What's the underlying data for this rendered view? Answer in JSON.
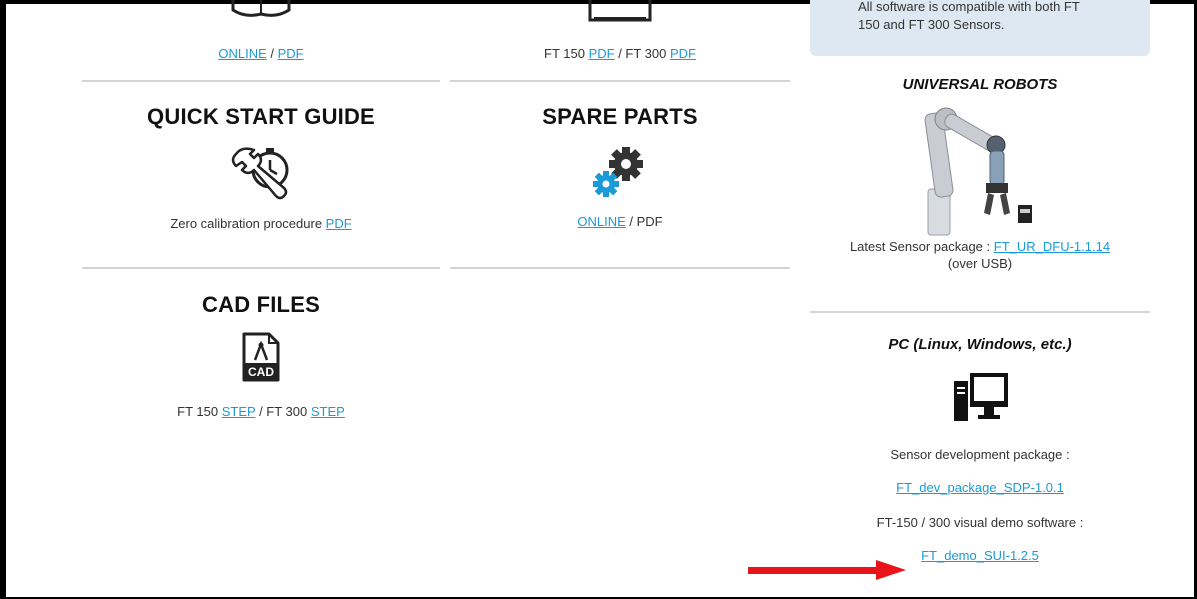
{
  "manuals": {
    "online_label": "ONLINE",
    "sep": " / ",
    "pdf_label": "PDF"
  },
  "drawings": {
    "ft150_text": "FT 150 ",
    "ft150_link": "PDF",
    "mid_text": " / FT 300 ",
    "ft300_link": "PDF"
  },
  "quick_start": {
    "title": "QUICK START GUIDE",
    "text": "Zero calibration procedure ",
    "pdf_link": "PDF"
  },
  "spare_parts": {
    "title": "SPARE PARTS",
    "online_link": "ONLINE",
    "rest": " / PDF"
  },
  "cad_files": {
    "title": "CAD FILES",
    "icon_text": "CAD",
    "ft150_text": "FT 150 ",
    "ft150_link": "STEP",
    "mid_text": " / FT 300 ",
    "ft300_link": "STEP"
  },
  "notice": {
    "text": "All software is compatible with both FT 150 and FT 300 Sensors."
  },
  "universal_robots": {
    "title": "UNIVERSAL ROBOTS",
    "package_text": "Latest Sensor package : ",
    "package_link": "FT_UR_DFU-1.1.14",
    "usb_note": "(over USB)"
  },
  "pc": {
    "title": "PC (Linux, Windows, etc.)",
    "sdp_label": "Sensor development package :",
    "sdp_link": "FT_dev_package_SDP-1.0.1",
    "demo_label": "FT-150 / 300 visual demo software :",
    "demo_link": "FT_demo_SUI-1.2.5"
  },
  "icons": [
    "book-icon",
    "monitor-drawing-icon",
    "wrench-stopwatch-icon",
    "gears-icon",
    "cad-file-icon",
    "robot-arm-image",
    "desktop-computer-icon",
    "red-arrow-annotation"
  ],
  "colors": {
    "link": "#1a9ad6",
    "notice_bg": "#dde8f2",
    "arrow": "#e8141a",
    "gear_blue": "#1a9ad6",
    "gear_dark": "#333333"
  }
}
